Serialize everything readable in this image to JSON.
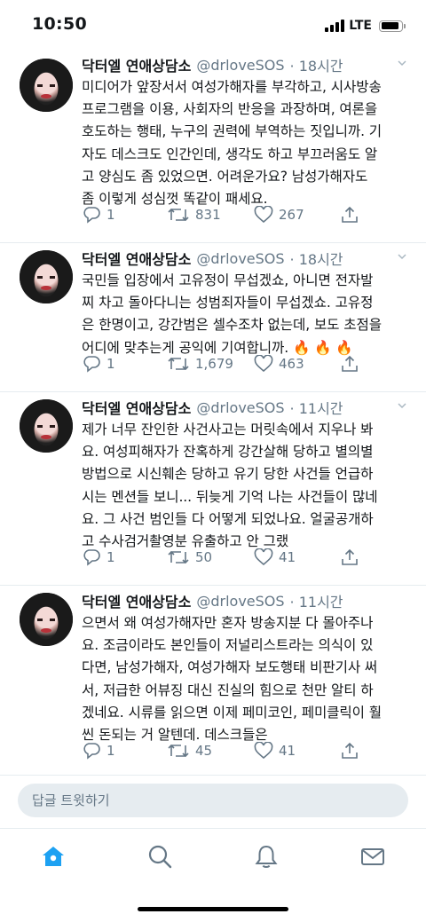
{
  "status_bar": {
    "time": "10:50",
    "network": "LTE",
    "battery_level": 0.9
  },
  "tweets": [
    {
      "name": "닥터엘 연애상담소",
      "handle": "@drloveSOS",
      "time": "· 18시간",
      "text": "미디어가 앞장서서 여성가해자를 부각하고, 시사방송\n프로그램을 이용, 사회자의 반응을 과장하며, 여론을\n호도하는 행태, 누구의 권력에 부역하는 짓입니까. 기\n자도 데스크도 인간인데, 생각도 하고 부끄러움도 알\n고 양심도 좀 있었으면. 어려운가요? 남성가해자도\n좀 이렇게 성심껏 똑같이 패세요.",
      "replies": "1",
      "retweets": "831",
      "likes": "267"
    },
    {
      "name": "닥터엘 연애상담소",
      "handle": "@drloveSOS",
      "time": "· 18시간",
      "text": "국민들 입장에서 고유정이 무섭겠쇼, 아니면 전자발\n찌 차고 돌아다니는 성범죄자들이 무섭겠쇼. 고유정\n은 한명이고, 강간범은 셀수조차 없는데, 보도 초점을\n어디에 맞추는게 공익에 기여합니까. 🔥 🔥 🔥",
      "replies": "1",
      "retweets": "1,679",
      "likes": "463"
    },
    {
      "name": "닥터엘 연애상담소",
      "handle": "@drloveSOS",
      "time": "· 11시간",
      "text": "제가 너무 잔인한 사건사고는 머릿속에서 지우나 봐\n요. 여성피해자가 잔혹하게 강간살해 당하고 별의별\n방법으로 시신훼손 당하고 유기 당한 사건들 언급하\n시는 멘션들 보니... 뒤늦게 기억 나는 사건들이 많네\n요. 그 사건 범인들 다 어떻게 되었나요. 얼굴공개하\n고 수사검거촬영분 유출하고 안 그랬",
      "replies": "1",
      "retweets": "50",
      "likes": "41"
    },
    {
      "name": "닥터엘 연애상담소",
      "handle": "@drloveSOS",
      "time": "· 11시간",
      "text": "으면서 왜 여성가해자만 혼자 방송지분 다 몰아주나\n요. 조금이라도 본인들이 저널리스트라는 의식이 있\n다면, 남성가해자, 여성가해자 보도행태 비판기사 써\n서, 저급한 어뷰징 대신 진실의 힘으로 천만 알티 하\n겠네요. 시류를 읽으면 이제 페미코인, 페미클릭이 훨\n씬 돈되는 거 알텐데. 데스크들은",
      "replies": "1",
      "retweets": "45",
      "likes": "41"
    }
  ],
  "reply_bar": {
    "placeholder": "답글 트윗하기"
  },
  "tabbar": {
    "tabs": [
      {
        "name": "home",
        "icon": "home-icon",
        "active": true
      },
      {
        "name": "search",
        "icon": "search-icon",
        "active": false
      },
      {
        "name": "notifications",
        "icon": "bell-icon",
        "active": false
      },
      {
        "name": "messages",
        "icon": "mail-icon",
        "active": false
      }
    ]
  },
  "colors": {
    "accent": "#1da1f2",
    "secondary_text": "#657786",
    "divider": "#e6ecf0"
  }
}
